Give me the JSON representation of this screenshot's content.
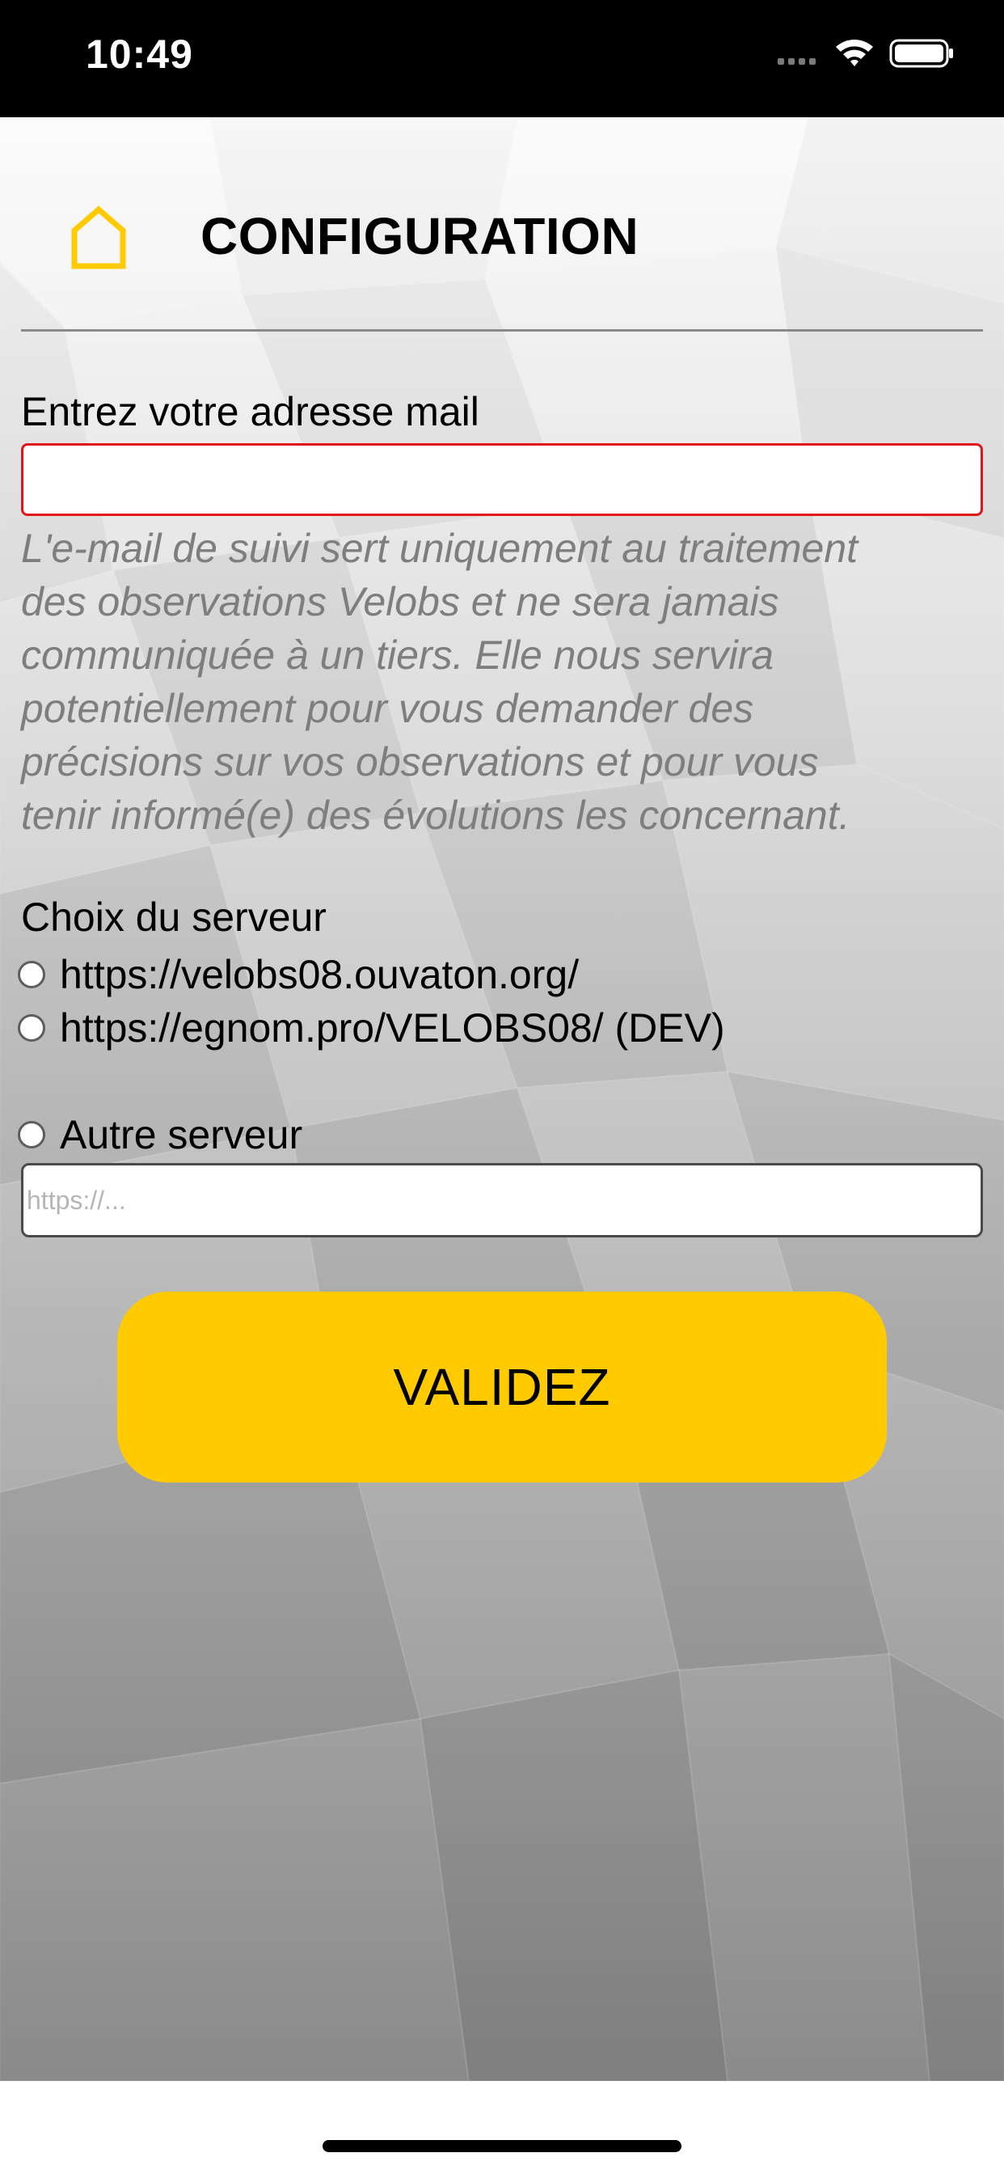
{
  "status_bar": {
    "time": "10:49",
    "icons": [
      "signal-icon",
      "wifi-icon",
      "battery-icon"
    ]
  },
  "header": {
    "home_icon": "home-icon",
    "title": "CONFIGURATION"
  },
  "email": {
    "label": "Entrez votre adresse mail",
    "value": "",
    "placeholder": "",
    "note_lines": [
      "L'e-mail de suivi sert uniquement au traitement",
      "des observations Velobs et ne sera jamais",
      "communiquée à un tiers. Elle nous servira",
      "potentiellement pour vous demander des",
      "précisions sur vos observations et pour vous",
      "tenir informé(e) des évolutions les concernant."
    ]
  },
  "server": {
    "heading": "Choix du serveur",
    "options": [
      {
        "label": "https://velobs08.ouvaton.org/",
        "selected": false
      },
      {
        "label": "https://egnom.pro/VELOBS08/ (DEV)",
        "selected": false
      }
    ],
    "other": {
      "label": "Autre serveur",
      "selected": false,
      "value": "",
      "placeholder": "https://..."
    }
  },
  "submit": {
    "label": "VALIDEZ"
  },
  "colors": {
    "accent": "#ffca00",
    "error_border": "#e0161b",
    "note_text": "#7e7e7e"
  }
}
